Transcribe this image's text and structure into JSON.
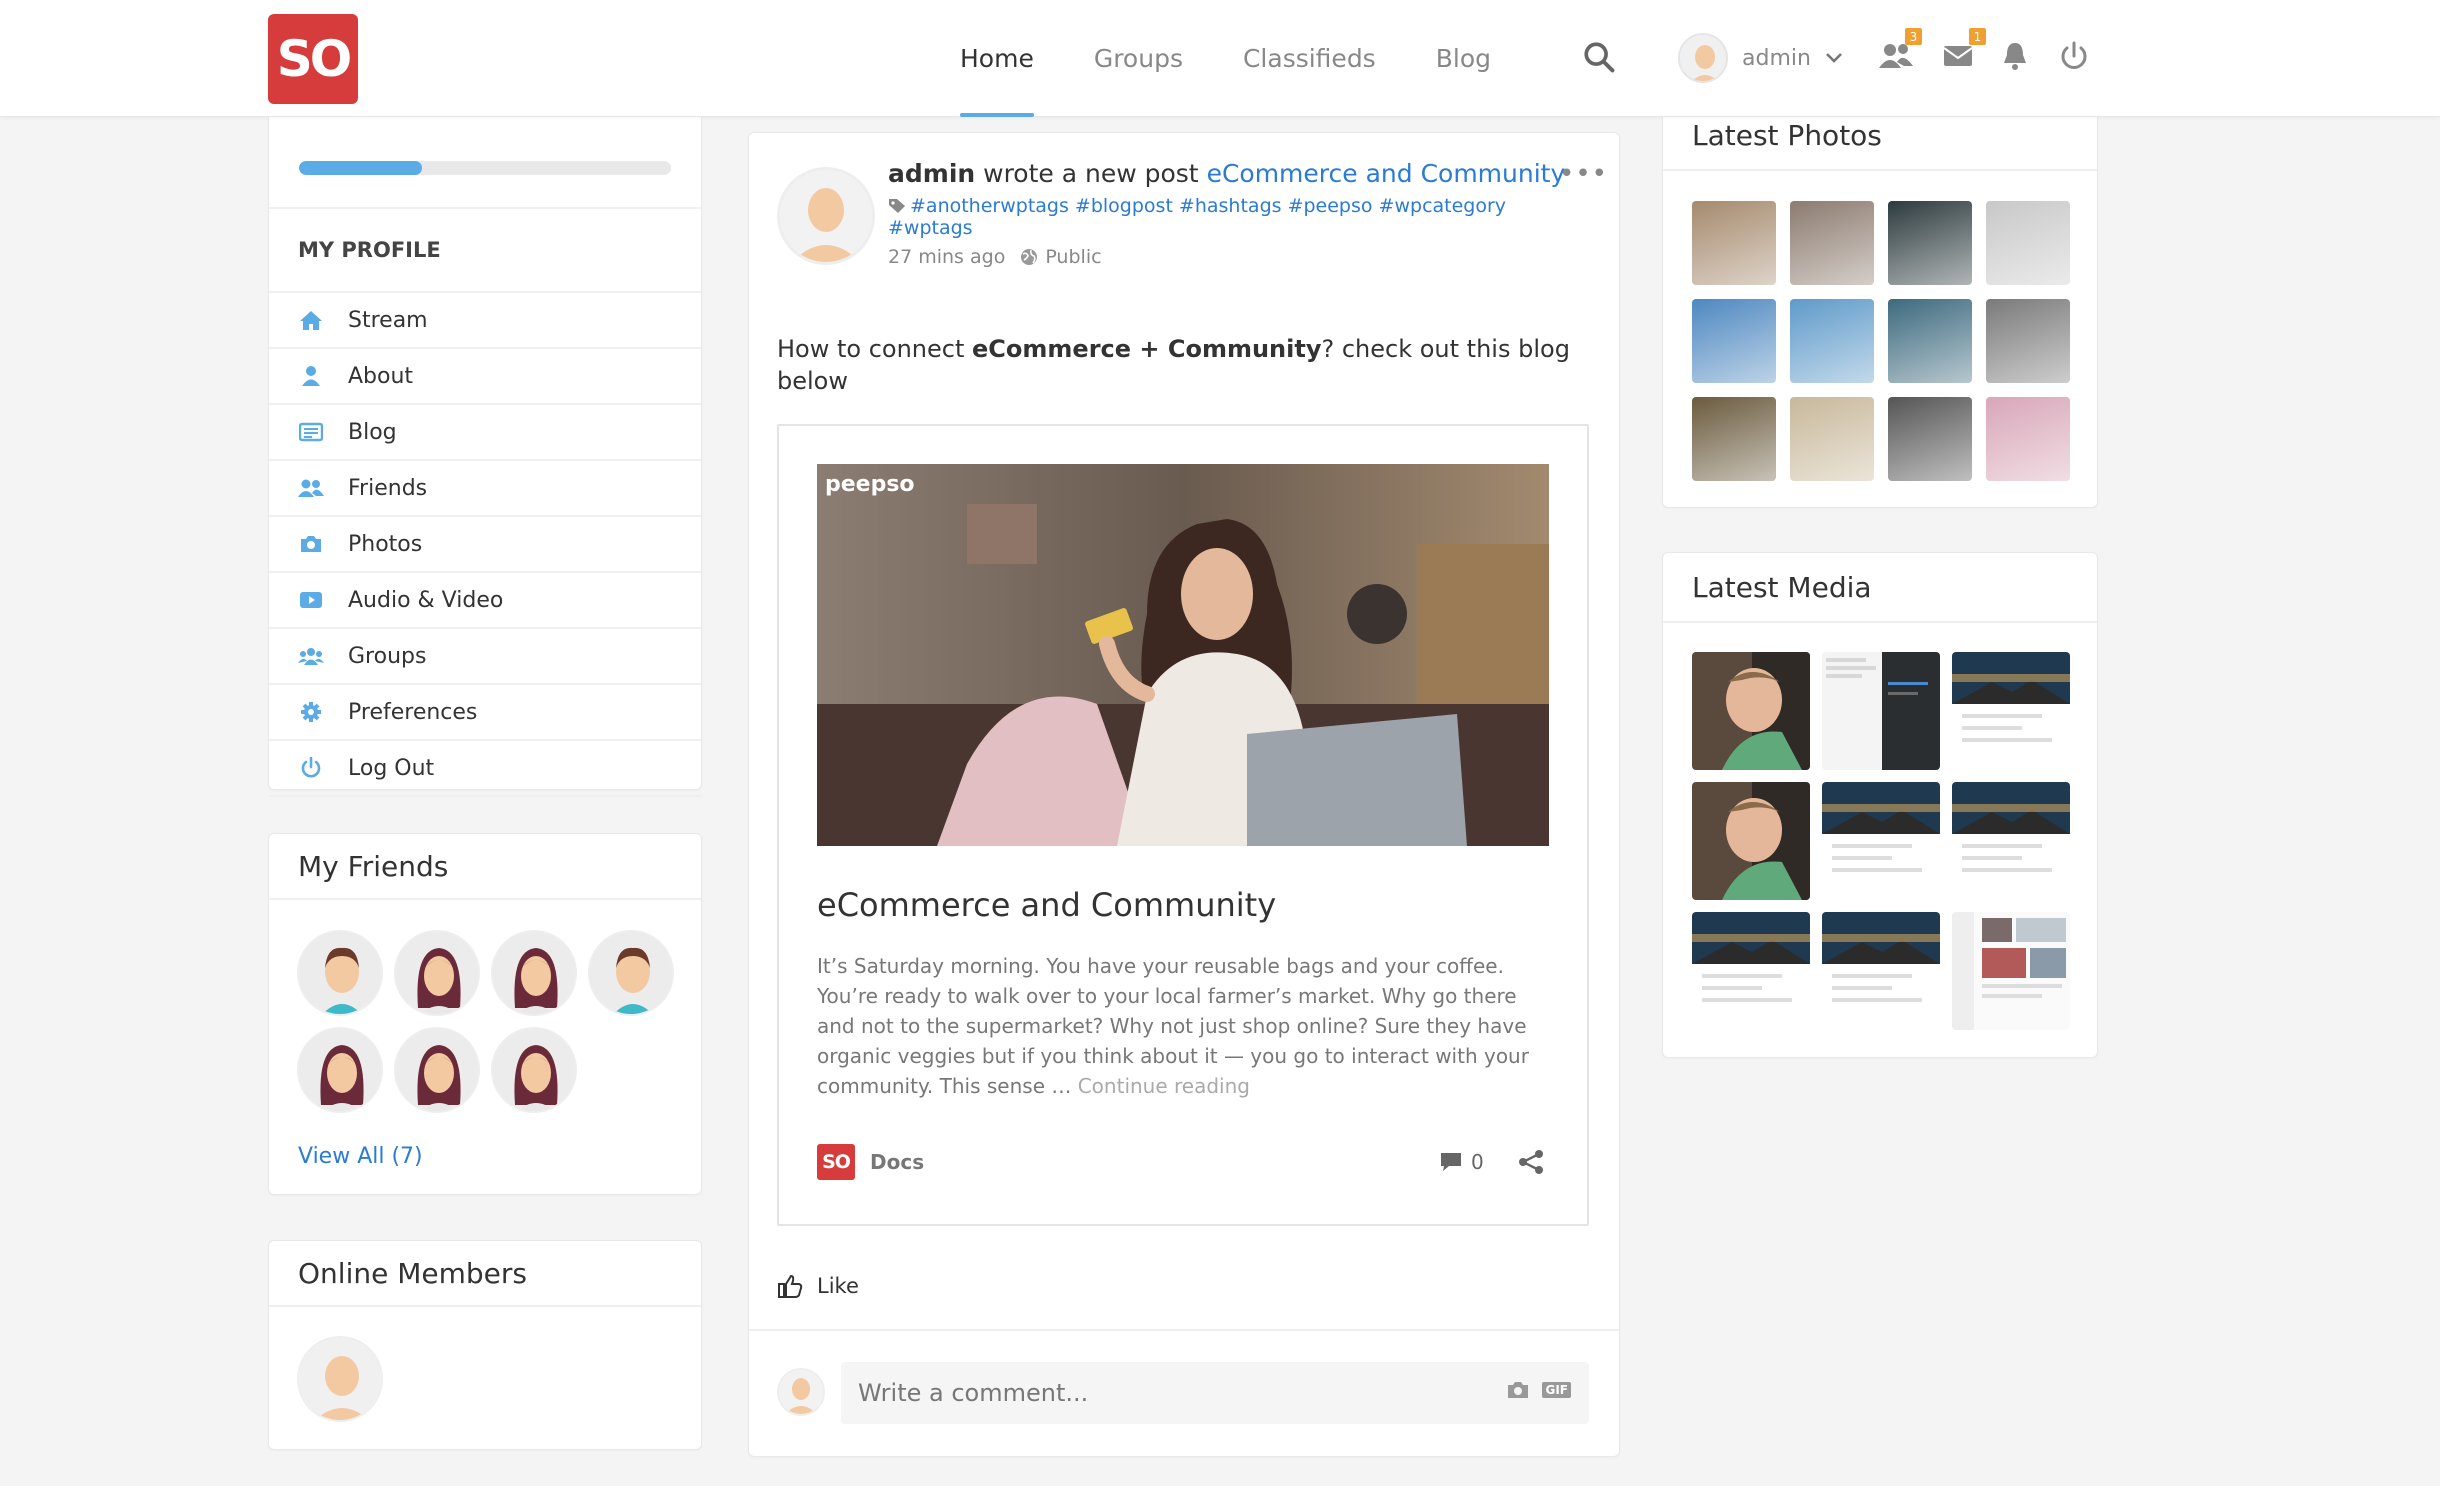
{
  "header": {
    "logo_text": "SO",
    "nav": [
      "Home",
      "Groups",
      "Classifieds",
      "Blog"
    ],
    "user_name": "admin",
    "friend_requests_count": "3",
    "messages_count": "1",
    "icons": [
      "search-icon",
      "chevron-down-icon",
      "friends-icon",
      "envelope-icon",
      "bell-icon",
      "power-icon"
    ]
  },
  "profile": {
    "progress": 0.33,
    "section_title": "MY PROFILE",
    "menu": [
      {
        "label": "Stream",
        "icon": "home-icon"
      },
      {
        "label": "About",
        "icon": "user-icon"
      },
      {
        "label": "Blog",
        "icon": "blog-icon"
      },
      {
        "label": "Friends",
        "icon": "friends-icon"
      },
      {
        "label": "Photos",
        "icon": "camera-icon"
      },
      {
        "label": "Audio & Video",
        "icon": "video-icon"
      },
      {
        "label": "Groups",
        "icon": "groups-icon"
      },
      {
        "label": "Preferences",
        "icon": "gear-icon"
      },
      {
        "label": "Log Out",
        "icon": "power-icon"
      }
    ]
  },
  "friends": {
    "title": "My Friends",
    "view_all": "View All (7)"
  },
  "online": {
    "title": "Online Members"
  },
  "post": {
    "author": "admin",
    "action": " wrote a new post ",
    "post_link": "eCommerce and Community",
    "tags": "#anotherwptags #blogpost #hashtags #peepso #wpcategory #wptags",
    "time": "27 mins ago",
    "privacy": "Public",
    "more": "•••",
    "text_before": "How to connect ",
    "text_bold": "eCommerce + Community",
    "text_after": "? check out this blog below",
    "embed": {
      "watermark": "peepso",
      "title": "eCommerce and Community",
      "excerpt": "It’s Saturday morning. You have your reusable bags and your coffee. You’re ready to walk over to your local farmer’s market. Why go there and not to the supermarket? Why not just shop online? Sure they have organic veggies but if you think about it — you go to interact with your community.  This sense … ",
      "continue": "Continue reading",
      "source_logo": "SO",
      "source": "Docs",
      "comments": "0"
    },
    "like": "Like",
    "comment_placeholder": "Write a comment...",
    "gif": "GIF"
  },
  "latest_photos": {
    "title": "Latest Photos",
    "colors": [
      "#a58a6d",
      "#8c7b6f",
      "#2d3b3e",
      "#c8c8c8",
      "#4e88c0",
      "#5f9ac9",
      "#3d6a7e",
      "#7a7a7a",
      "#6b5b3e",
      "#c8b89a",
      "#555555",
      "#d8a6b8"
    ]
  },
  "latest_media": {
    "title": "Latest Media"
  }
}
